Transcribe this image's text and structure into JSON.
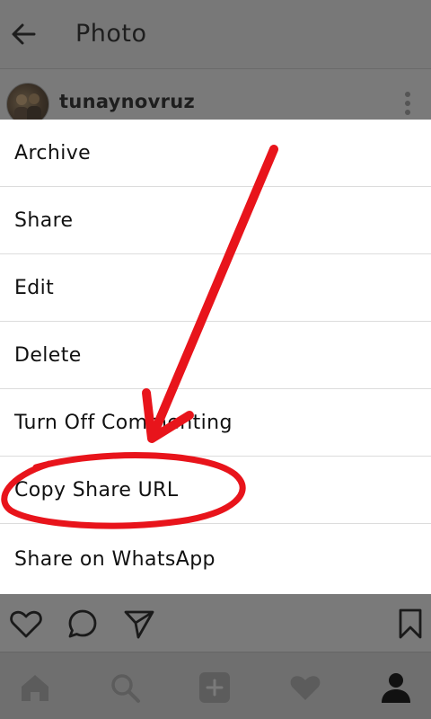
{
  "header": {
    "title": "Photo"
  },
  "post": {
    "username": "tunaynovruz"
  },
  "menu": {
    "items": [
      {
        "label": "Archive"
      },
      {
        "label": "Share"
      },
      {
        "label": "Edit"
      },
      {
        "label": "Delete"
      },
      {
        "label": "Turn Off Commenting"
      },
      {
        "label": "Copy Share URL"
      },
      {
        "label": "Share on WhatsApp"
      }
    ]
  },
  "icons": {
    "back": "arrow-left-icon",
    "more": "more-vertical-icon",
    "like": "heart-icon",
    "comment": "comment-icon",
    "share": "send-icon",
    "save": "bookmark-icon",
    "nav_home": "home-icon",
    "nav_search": "search-icon",
    "nav_add": "add-post-icon",
    "nav_activity": "heart-icon",
    "nav_profile": "profile-icon"
  },
  "colors": {
    "overlay": "#7a7a7a",
    "menu_bg": "#ffffff",
    "annotation": "#e8141b",
    "text": "#111111"
  }
}
